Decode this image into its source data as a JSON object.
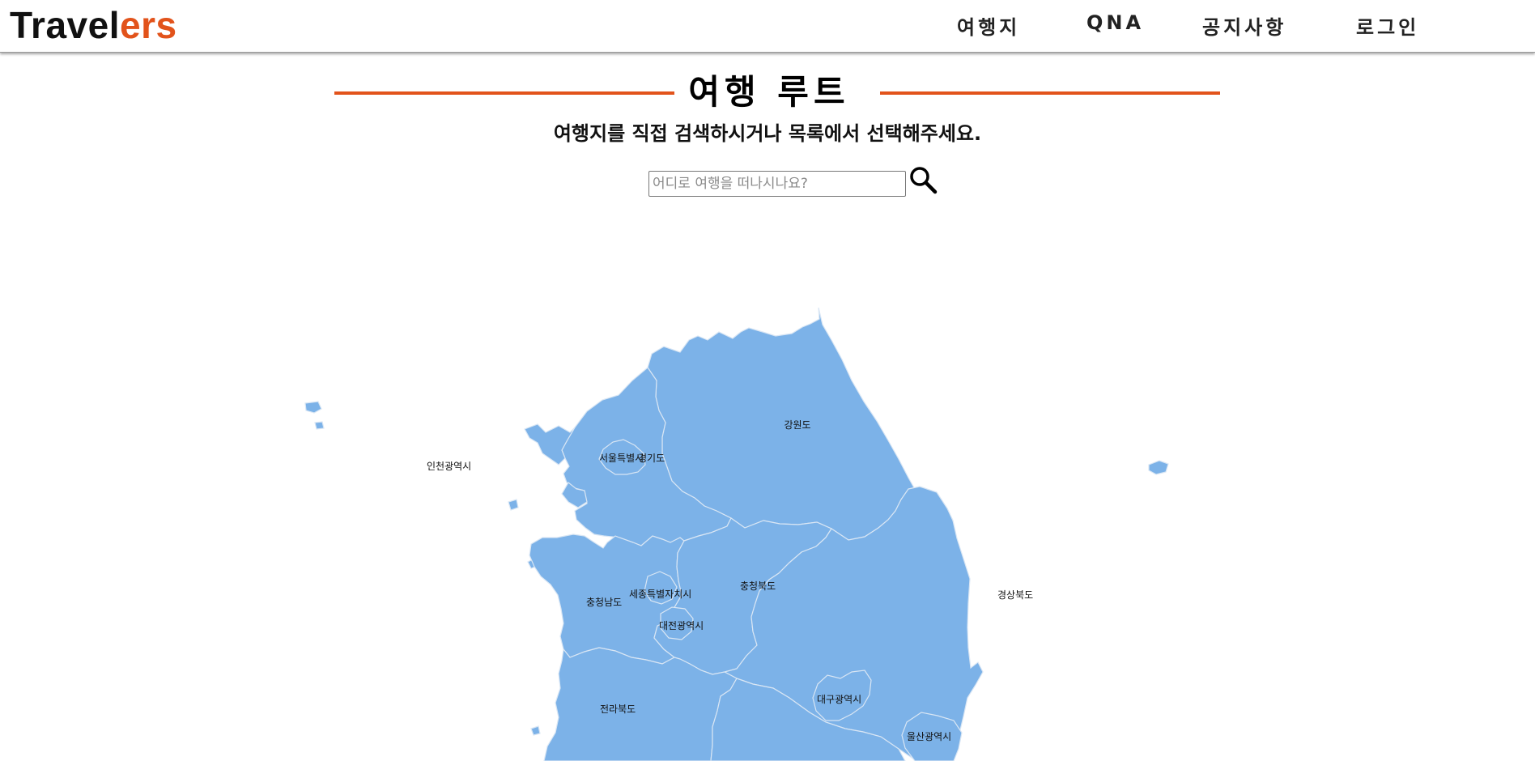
{
  "header": {
    "logo_main": "Travel",
    "logo_accent": "ers",
    "nav": [
      "여행지",
      "QNA",
      "공지사항",
      "로그인"
    ]
  },
  "page": {
    "title": "여행 루트",
    "subtitle": "여행지를 직접 검색하시거나 목록에서 선택해주세요."
  },
  "search": {
    "placeholder": "어디로 여행을 떠나시나요?",
    "icon": "search-icon"
  },
  "map": {
    "regions": [
      "강원도",
      "서울특별시",
      "경기도",
      "인천광역시",
      "충청북도",
      "충청남도",
      "세종특별자치시",
      "대전광역시",
      "경상북도",
      "전라북도",
      "대구광역시",
      "울산광역시"
    ]
  },
  "colors": {
    "accent": "#e2531b",
    "map_fill": "#7cb2e8",
    "map_border": "#d9e6f4"
  }
}
